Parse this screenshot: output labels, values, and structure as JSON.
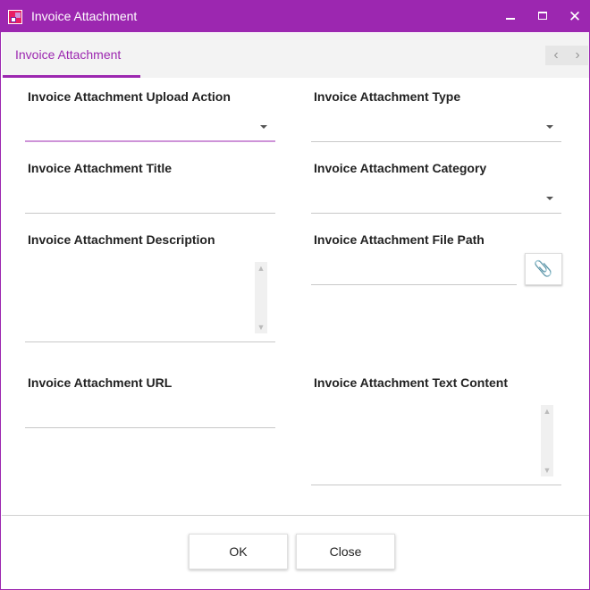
{
  "window": {
    "title": "Invoice Attachment"
  },
  "title_controls": {
    "minimize_icon": "minimize-icon",
    "maximize_icon": "maximize-icon",
    "close_glyph": "✕"
  },
  "tabs": [
    {
      "label": "Invoice Attachment",
      "selected": true
    }
  ],
  "tab_nav": {
    "left": "‹",
    "right": "›"
  },
  "form": {
    "upload_action": {
      "label": "Invoice Attachment Upload Action",
      "value": ""
    },
    "attachment_type": {
      "label": "Invoice Attachment Type",
      "value": ""
    },
    "title": {
      "label": "Invoice Attachment Title",
      "value": ""
    },
    "category": {
      "label": "Invoice Attachment Category",
      "value": ""
    },
    "description": {
      "label": "Invoice Attachment Description",
      "value": ""
    },
    "file_path": {
      "label": "Invoice Attachment File Path",
      "value": "",
      "button_icon": "paperclip-icon",
      "button_glyph": "📎"
    },
    "url": {
      "label": "Invoice Attachment URL",
      "value": ""
    },
    "text_content": {
      "label": "Invoice Attachment Text Content",
      "value": ""
    }
  },
  "scroll_glyphs": {
    "up": "▲",
    "down": "▼"
  },
  "buttons": {
    "ok": "OK",
    "close": "Close"
  },
  "colors": {
    "accent": "#9c27b0",
    "active_underline": "#ce93d8",
    "tab_strip": "#f3f3f3"
  }
}
